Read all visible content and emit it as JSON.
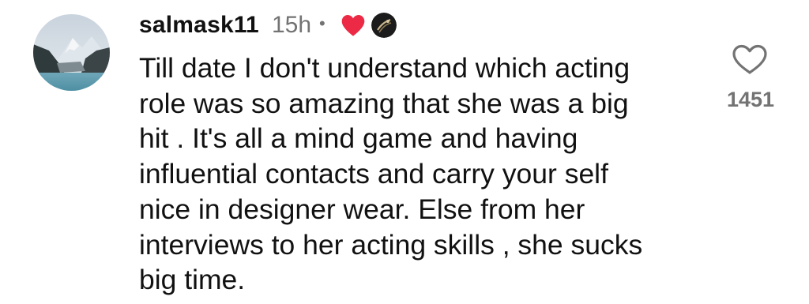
{
  "comment": {
    "username": "salmask11",
    "time_ago": "15h",
    "separator": "•",
    "text": "Till date I don't understand which acting\nrole was so amazing that she was a big\nhit . It's all a mind game and having\ninfluential contacts and carry your self\nnice in designer wear. Else from her\ninterviews to her acting skills , she sucks\nbig time.",
    "like_count": "1451",
    "creator_liked": true,
    "colors": {
      "text": "#111111",
      "muted": "#737373",
      "creator_heart": "#ed2a45"
    }
  }
}
